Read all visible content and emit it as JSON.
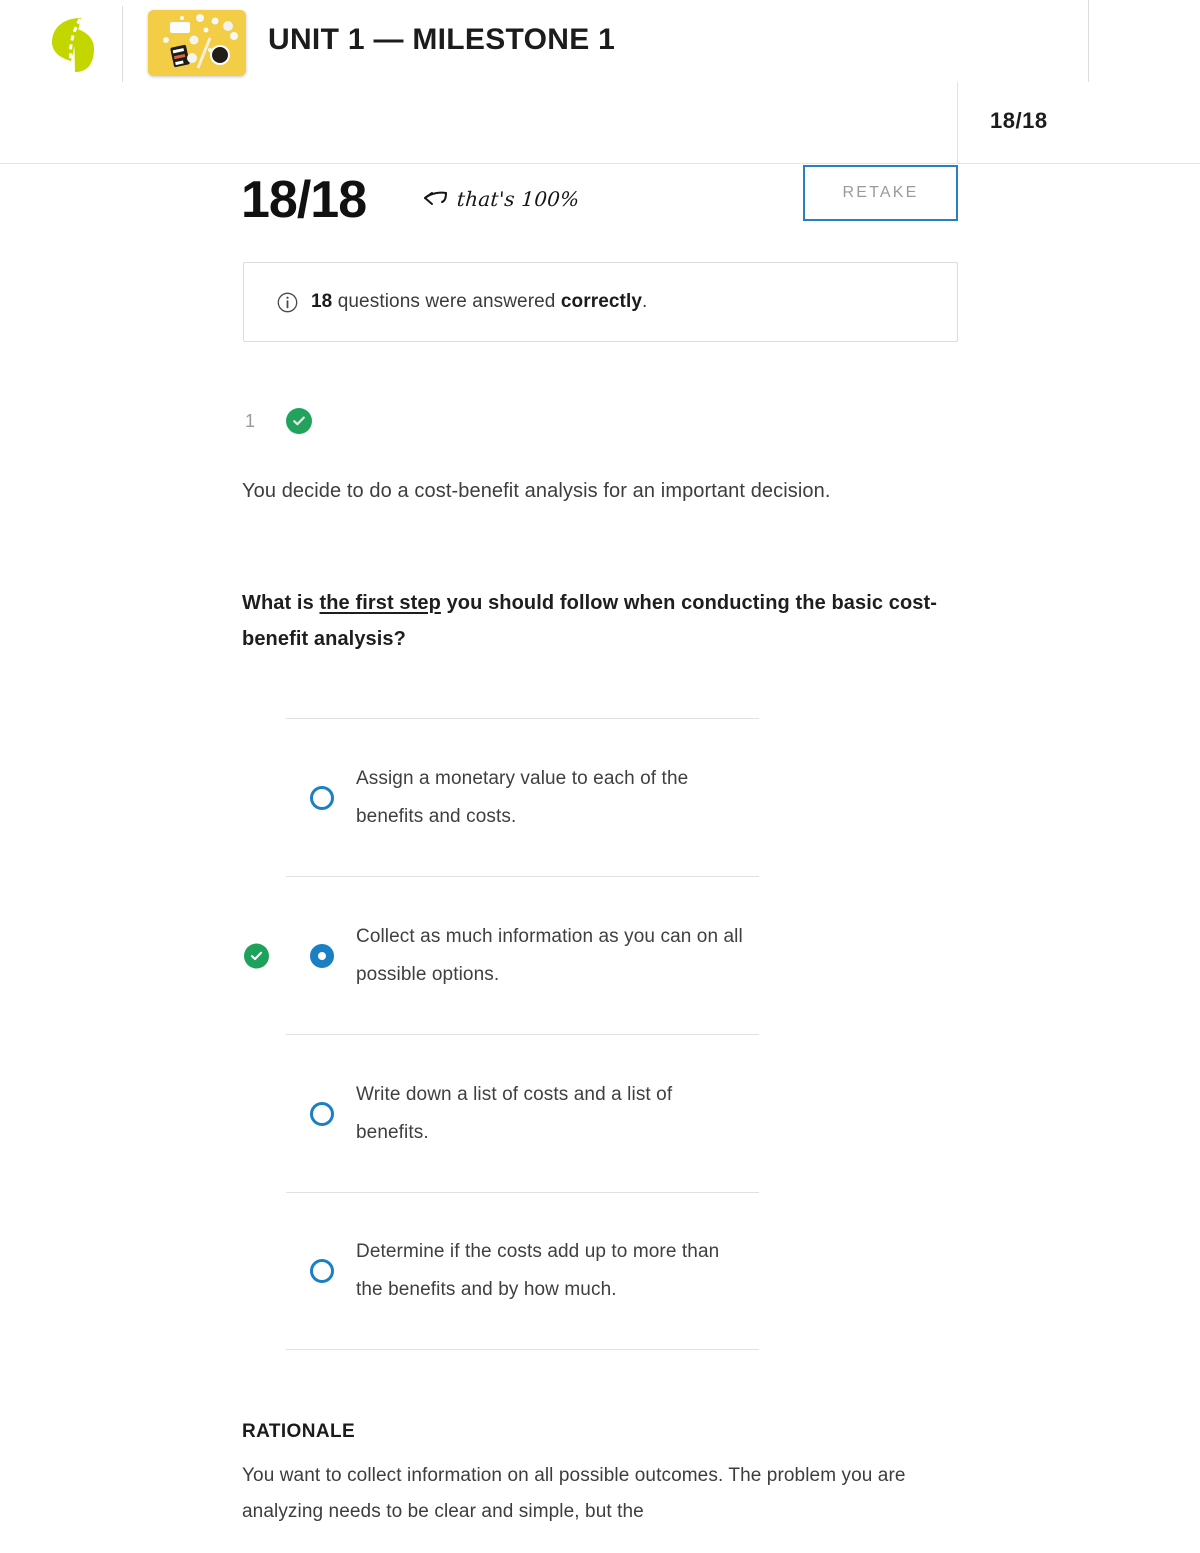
{
  "header": {
    "logo_icon": "sophia-logo-icon",
    "thumbnail_icon": "course-thumbnail-image",
    "unit_title": "UNIT 1 — MILESTONE 1",
    "score_badge": "18/18"
  },
  "score_row": {
    "score": "18/18",
    "annotation": "that's 100%",
    "annotation_arrow_icon": "curved-left-arrow-icon",
    "retake_label": "RETAKE"
  },
  "info_box": {
    "icon": "info-circle-icon",
    "count": "18",
    "text_middle": " questions were answered ",
    "emphasis": "correctly",
    "text_end": "."
  },
  "question": {
    "number": "1",
    "status_icon": "check-circle-icon",
    "stem": "You decide to do a cost-benefit analysis for an important decision.",
    "prompt_before": "What is ",
    "prompt_underlined": "the first step",
    "prompt_after": " you should follow when conducting the basic cost-benefit analysis?",
    "options": [
      {
        "label": "Assign a monetary value to each of the benefits and costs.",
        "selected": false,
        "correct": false
      },
      {
        "label": "Collect as much information as you can on all possible options.",
        "selected": true,
        "correct": true
      },
      {
        "label": "Write down a list of costs and a list of benefits.",
        "selected": false,
        "correct": false
      },
      {
        "label": "Determine if the costs add up to more than the benefits and by how much.",
        "selected": false,
        "correct": false
      }
    ]
  },
  "rationale": {
    "title": "RATIONALE",
    "body": "You want to collect information on all possible outcomes. The problem you are analyzing needs to be clear and simple, but the"
  },
  "colors": {
    "accent_blue": "#1b7fc4",
    "correct_green": "#1ea15b",
    "logo_lime": "#c3d600",
    "muted_gray": "#9a9a9a"
  }
}
